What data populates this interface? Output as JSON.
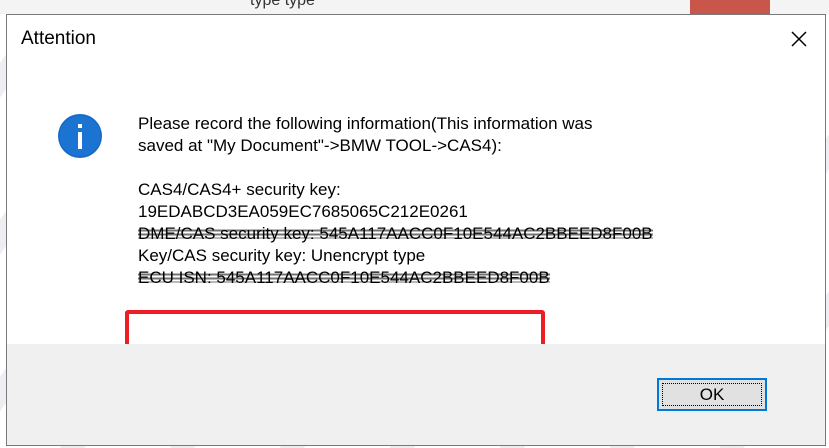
{
  "window": {
    "title": "Attention",
    "close_label": "✕"
  },
  "background": {
    "partial_text": "type                                    type"
  },
  "icons": {
    "info": "info-icon",
    "close": "close-icon"
  },
  "message": {
    "intro_line1": "Please record the following information(This information was",
    "intro_line2": "saved at \"My Document\"->BMW TOOL->CAS4):",
    "cas_key_label": "CAS4/CAS4+ security key:",
    "cas_key_value": "19EDABCD3EA059EC7685065C212E0261",
    "dme_line": "DME/CAS security key: 545A117AACC0F10E544AC2BBEED8F00B",
    "key_cas_line": "Key/CAS security key: Unencrypt type",
    "ecu_line": "ECU ISN: 545A117AACC0F10E544AC2BBEED8F00B"
  },
  "buttons": {
    "ok_label": "OK"
  },
  "colors": {
    "info_blue": "#1b74d1",
    "highlight_red": "#ee1c24",
    "focus_blue": "#0078d7"
  }
}
